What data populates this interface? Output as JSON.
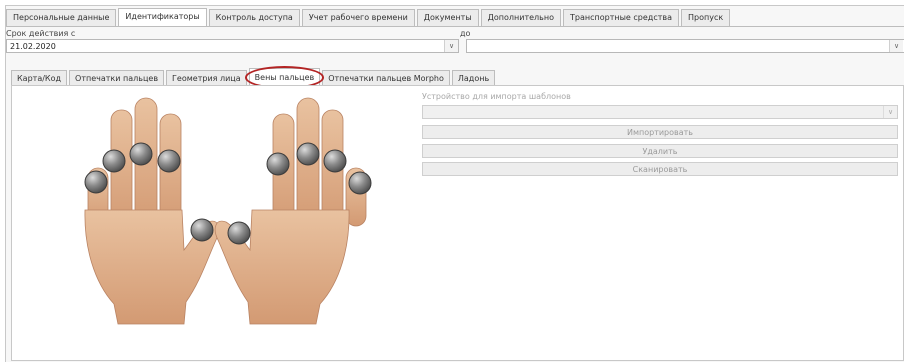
{
  "top_tabs": [
    {
      "label": "Персональные данные"
    },
    {
      "label": "Идентификаторы",
      "active": true
    },
    {
      "label": "Контроль доступа"
    },
    {
      "label": "Учет рабочего времени"
    },
    {
      "label": "Документы"
    },
    {
      "label": "Дополнительно"
    },
    {
      "label": "Транспортные средства"
    },
    {
      "label": "Пропуск"
    }
  ],
  "validity": {
    "from_label": "Срок действия с",
    "from_value": "21.02.2020",
    "to_label": "до",
    "to_value": ""
  },
  "inner_tabs": [
    {
      "label": "Карта/Код"
    },
    {
      "label": "Отпечатки пальцев"
    },
    {
      "label": "Геометрия лица"
    },
    {
      "label": "Вены пальцев",
      "active": true,
      "highlighted": true
    },
    {
      "label": "Отпечатки пальцев Morpho"
    },
    {
      "label": "Ладонь"
    }
  ],
  "device": {
    "label": "Устройство для импорта шаблонов",
    "value": ""
  },
  "buttons": {
    "import": "Импортировать",
    "delete": "Удалить",
    "scan": "Сканировать"
  },
  "colors": {
    "highlight": "#b32424",
    "skin": "#e2b48e",
    "finger_marker": "#7d7d7d"
  }
}
